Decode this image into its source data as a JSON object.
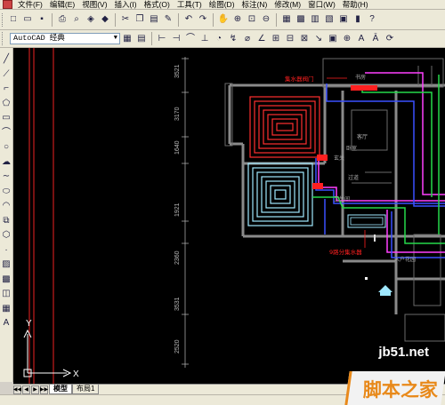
{
  "menubar": {
    "items": [
      "文件(F)",
      "编辑(E)",
      "视图(V)",
      "插入(I)",
      "格式(O)",
      "工具(T)",
      "绘图(D)",
      "标注(N)",
      "修改(M)",
      "窗口(W)",
      "帮助(H)"
    ]
  },
  "toolbar": {
    "workspace_value": "AutoCAD 经典"
  },
  "drawing": {
    "annotations": {
      "valve_top": "集水器阀门",
      "valve_bottom": "9路分集水器",
      "room_living": "客厅",
      "room_hall": "入户花园",
      "room_kitchen": "卧室",
      "room_corridor": "过道",
      "room_bath": "卫生间",
      "room_study": "书房",
      "room_entry": "玄关"
    },
    "dimensions": [
      "3521",
      "3170",
      "1640",
      "1921",
      "2360",
      "3531",
      "2520"
    ],
    "ucs": {
      "y_label": "Y",
      "x_label": "X"
    },
    "colors": {
      "background": "#000000",
      "walls": "#8a8a8a",
      "heating_red": "#ff3030",
      "heating_cyan": "#9fe8ff",
      "supply_blue": "#3a50ff",
      "supply_green": "#25d94a",
      "magenta": "#ff40ff",
      "annotation_red": "#ff2020"
    }
  },
  "tabs": {
    "items": [
      "模型",
      "布局1"
    ],
    "active": "模型"
  },
  "watermark": {
    "top": "jb51.net",
    "bottom": "脚本之家"
  }
}
